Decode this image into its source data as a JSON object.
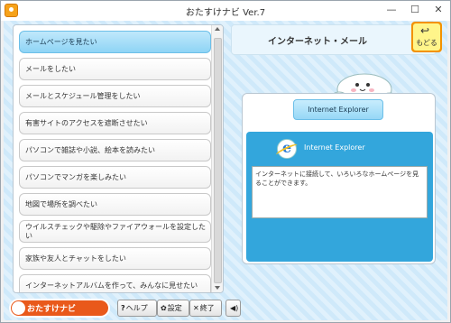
{
  "window": {
    "title": "おたすけナビ Ver.7",
    "minimize": "—",
    "maximize": "☐",
    "close": "✕"
  },
  "menu": {
    "items": [
      {
        "label": "ホームページを見たい"
      },
      {
        "label": "メールをしたい"
      },
      {
        "label": "メールとスケジュール管理をしたい"
      },
      {
        "label": "有害サイトのアクセスを遮断させたい"
      },
      {
        "label": "パソコンで雑誌や小説、絵本を読みたい"
      },
      {
        "label": "パソコンでマンガを楽しみたい"
      },
      {
        "label": "地図で場所を調べたい"
      },
      {
        "label": "ウイルスチェックや駆除やファイアウォールを設定したい"
      },
      {
        "label": "家族や友人とチャットをしたい"
      },
      {
        "label": "インターネットアルバムを作って、みんなに見せたい"
      }
    ]
  },
  "header": {
    "category_title": "インターネット・メール",
    "back_button_label": "もどる",
    "back_icon": "↩"
  },
  "detail": {
    "app_button_label": "Internet Explorer",
    "card_title": "Internet Explorer",
    "description": "インターネットに接続して、いろいろなホームページを見ることができます。"
  },
  "bottombar": {
    "logo_text": "おたすけナビ",
    "help_label": "ヘルプ",
    "help_icon": "?",
    "settings_label": "設定",
    "settings_icon": "✿",
    "exit_label": "終了",
    "exit_icon": "✕",
    "sound_icon": "◀)"
  },
  "colors": {
    "accent_orange": "#f39200",
    "selected_item": "#8fd4f5",
    "card_blue": "#33a6dc"
  }
}
